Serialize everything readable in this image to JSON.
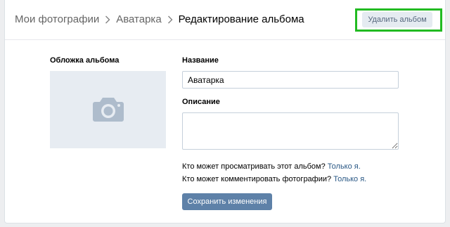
{
  "breadcrumb": {
    "items": [
      "Мои фотографии",
      "Аватарка"
    ],
    "current": "Редактирование альбома"
  },
  "header": {
    "delete_label": "Удалить альбом"
  },
  "cover": {
    "label": "Обложка альбома",
    "icon": "camera-icon"
  },
  "form": {
    "name_label": "Название",
    "name_value": "Аватарка",
    "description_label": "Описание",
    "description_value": ""
  },
  "privacy": {
    "view_question": "Кто может просматривать этот альбом?",
    "view_value": "Только я.",
    "comment_question": "Кто может комментировать фотографии?",
    "comment_value": "Только я."
  },
  "save_label": "Сохранить изменения",
  "colors": {
    "accent": "#5e81a8",
    "link": "#2a5885",
    "highlight": "#22bb22"
  }
}
